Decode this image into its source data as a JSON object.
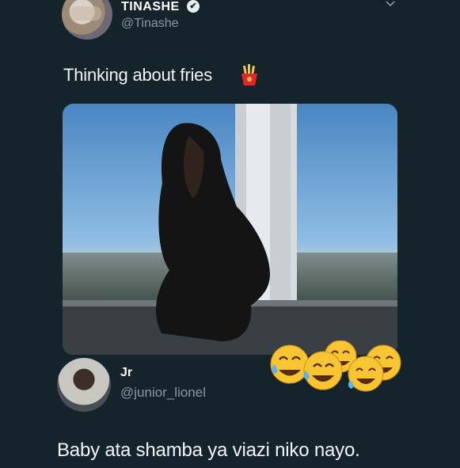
{
  "original_tweet": {
    "display_name": "TINASHE",
    "verified_glyph": "✔",
    "handle": "@Tinashe",
    "text": "Thinking about fries",
    "emoji_icon": "fries-icon"
  },
  "media": {
    "icon": "photo-woman-by-window"
  },
  "reply": {
    "display_name": "Jr",
    "handle": "@junior_lionel",
    "text": "Baby ata shamba ya viazi niko nayo.",
    "reaction_emojis": [
      "tears-of-joy-icon",
      "tears-of-joy-icon",
      "tears-of-joy-icon",
      "tears-of-joy-icon"
    ]
  },
  "colors": {
    "background": "#15232b",
    "text_primary": "#e8edf0",
    "text_secondary": "#8899a6"
  }
}
